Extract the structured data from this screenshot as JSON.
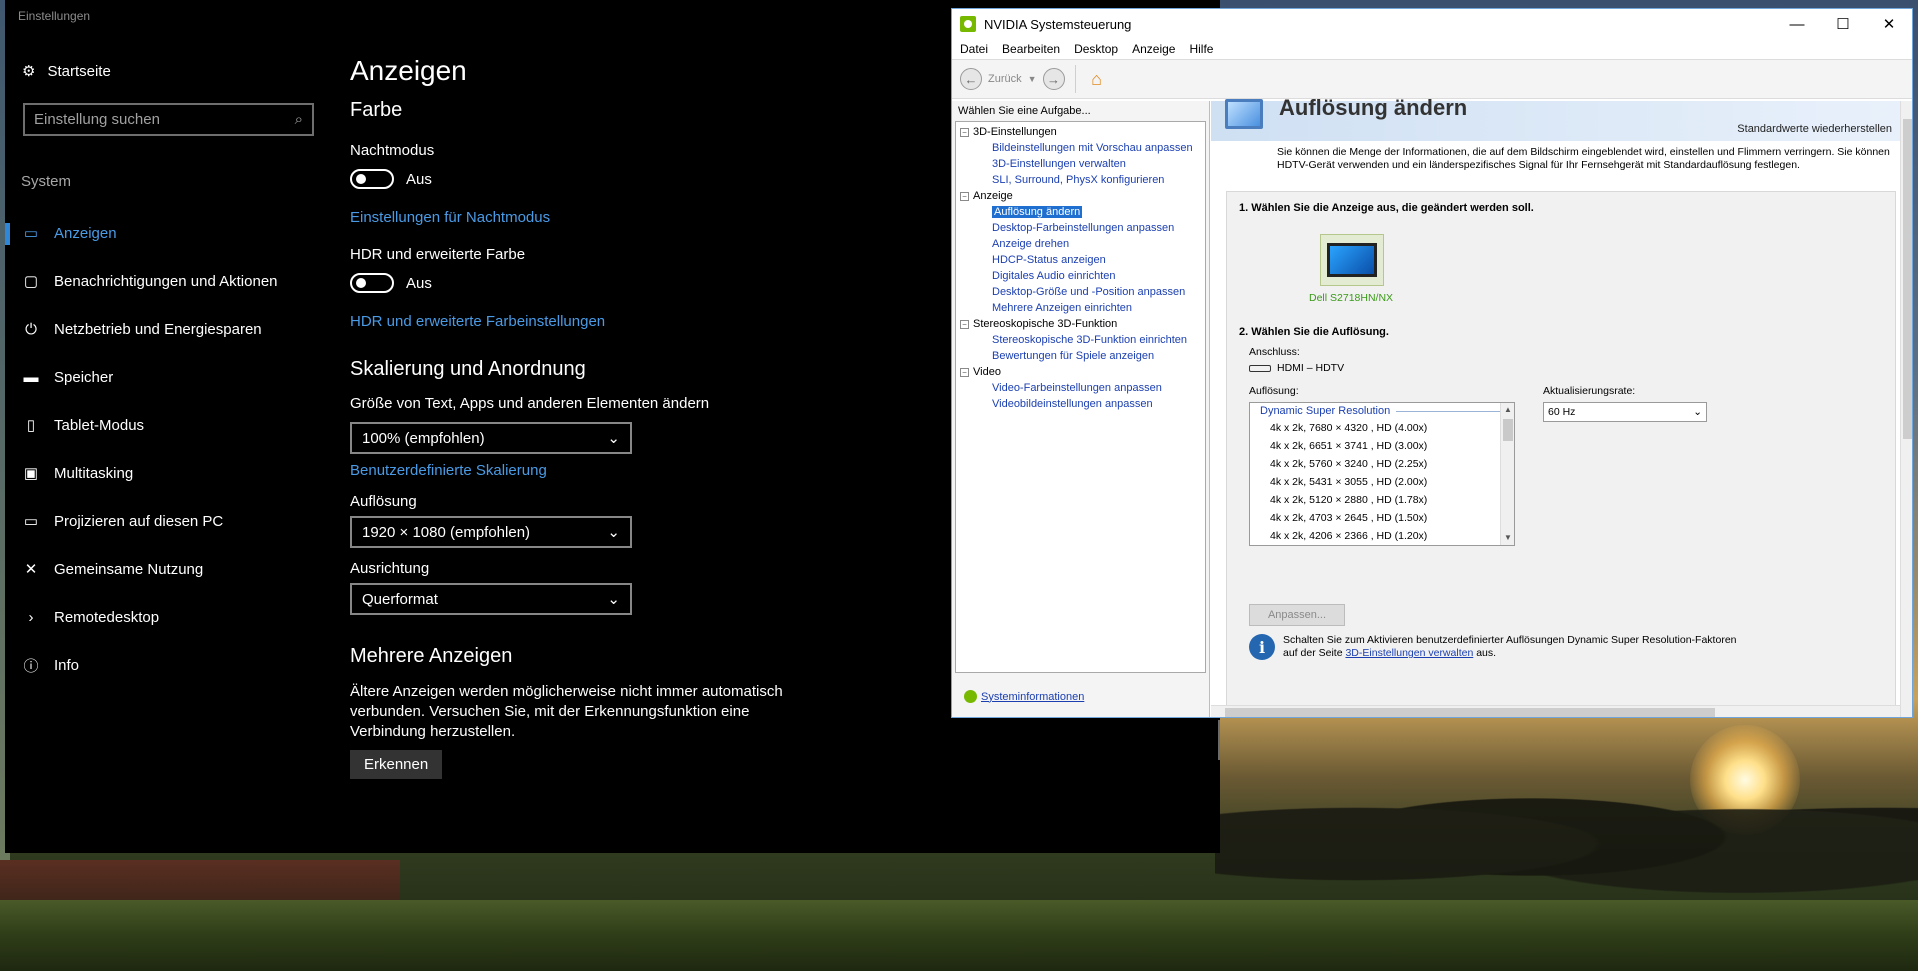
{
  "settings": {
    "window_title": "Einstellungen",
    "home": "Startseite",
    "search_placeholder": "Einstellung suchen",
    "section": "System",
    "nav": [
      {
        "label": "Anzeigen",
        "icon": "monitor-icon",
        "glyph": "▭"
      },
      {
        "label": "Benachrichtigungen und Aktionen",
        "icon": "notification-icon",
        "glyph": "▢"
      },
      {
        "label": "Netzbetrieb und Energiesparen",
        "icon": "power-icon",
        "glyph": "⏻"
      },
      {
        "label": "Speicher",
        "icon": "storage-icon",
        "glyph": "▬"
      },
      {
        "label": "Tablet-Modus",
        "icon": "tablet-icon",
        "glyph": "▯"
      },
      {
        "label": "Multitasking",
        "icon": "multitasking-icon",
        "glyph": "▣"
      },
      {
        "label": "Projizieren auf diesen PC",
        "icon": "project-icon",
        "glyph": "▭"
      },
      {
        "label": "Gemeinsame Nutzung",
        "icon": "share-icon",
        "glyph": "✕"
      },
      {
        "label": "Remotedesktop",
        "icon": "remote-desktop-icon",
        "glyph": "›"
      },
      {
        "label": "Info",
        "icon": "info-icon",
        "glyph": "ⓘ"
      }
    ],
    "main": {
      "title": "Anzeigen",
      "color_heading": "Farbe",
      "night_label": "Nachtmodus",
      "night_value": "Aus",
      "night_link": "Einstellungen für Nachtmodus",
      "hdr_label": "HDR und erweiterte Farbe",
      "hdr_value": "Aus",
      "hdr_link": "HDR und erweiterte Farbeinstellungen",
      "scale_heading": "Skalierung und Anordnung",
      "size_label": "Größe von Text, Apps und anderen Elementen ändern",
      "size_value": "100% (empfohlen)",
      "custom_link": "Benutzerdefinierte Skalierung",
      "resolution_label": "Auflösung",
      "resolution_value": "1920 × 1080 (empfohlen)",
      "orientation_label": "Ausrichtung",
      "orientation_value": "Querformat",
      "multi_heading": "Mehrere Anzeigen",
      "multi_text": "Ältere Anzeigen werden möglicherweise nicht immer automatisch verbunden. Versuchen Sie, mit der Erkennungsfunktion eine Verbindung herzustellen.",
      "detect_button": "Erkennen"
    }
  },
  "nvidia": {
    "title": "NVIDIA Systemsteuerung",
    "menu": [
      "Datei",
      "Bearbeiten",
      "Desktop",
      "Anzeige",
      "Hilfe"
    ],
    "back_label": "Zurück",
    "task_prompt": "Wählen Sie eine Aufgabe...",
    "tree": [
      {
        "category": "3D-Einstellungen",
        "tasks": [
          "Bildeinstellungen mit Vorschau anpassen",
          "3D-Einstellungen verwalten",
          "SLI, Surround, PhysX konfigurieren"
        ]
      },
      {
        "category": "Anzeige",
        "tasks": [
          "Auflösung ändern",
          "Desktop-Farbeinstellungen anpassen",
          "Anzeige drehen",
          "HDCP-Status anzeigen",
          "Digitales Audio einrichten",
          "Desktop-Größe und -Position anpassen",
          "Mehrere Anzeigen einrichten"
        ]
      },
      {
        "category": "Stereoskopische 3D-Funktion",
        "tasks": [
          "Stereoskopische 3D-Funktion einrichten",
          "Bewertungen für Spiele anzeigen"
        ]
      },
      {
        "category": "Video",
        "tasks": [
          "Video-Farbeinstellungen anpassen",
          "Videobildeinstellungen anpassen"
        ]
      }
    ],
    "selected_task": "Auflösung ändern",
    "sysinfo": "Systeminformationen",
    "page_title": "Auflösung ändern",
    "restore_defaults": "Standardwerte wiederherstellen",
    "description": "Sie können die Menge der Informationen, die auf dem Bildschirm eingeblendet wird, einstellen und Flimmern verringern. Sie können HDTV-Gerät verwenden und ein länderspezifisches Signal für Ihr Fernsehgerät mit Standardauflösung festlegen.",
    "step1": "1. Wählen Sie die Anzeige aus, die geändert werden soll.",
    "monitor_name": "Dell S2718HN/NX",
    "step2": "2. Wählen Sie die Auflösung.",
    "connection_label": "Anschluss:",
    "connection_value": "HDMI – HDTV",
    "resolution_label": "Auflösung:",
    "resolution_group": "Dynamic Super Resolution",
    "resolutions": [
      "4k x 2k, 7680 × 4320 , HD (4.00x)",
      "4k x 2k, 6651 × 3741 , HD (3.00x)",
      "4k x 2k, 5760 × 3240 , HD (2.25x)",
      "4k x 2k, 5431 × 3055 , HD (2.00x)",
      "4k x 2k, 5120 × 2880 , HD (1.78x)",
      "4k x 2k, 4703 × 2645 , HD (1.50x)",
      "4k x 2k, 4206 × 2366 , HD (1.20x)"
    ],
    "refresh_label": "Aktualisierungsrate:",
    "refresh_value": "60 Hz",
    "apply_button": "Anpassen...",
    "info_text_1": "Schalten Sie zum Aktivieren benutzerdefinierter Auflösungen Dynamic Super Resolution-Faktoren",
    "info_text_2a": "auf der Seite",
    "info_link": "3D-Einstellungen verwalten",
    "info_text_2b": "aus."
  }
}
